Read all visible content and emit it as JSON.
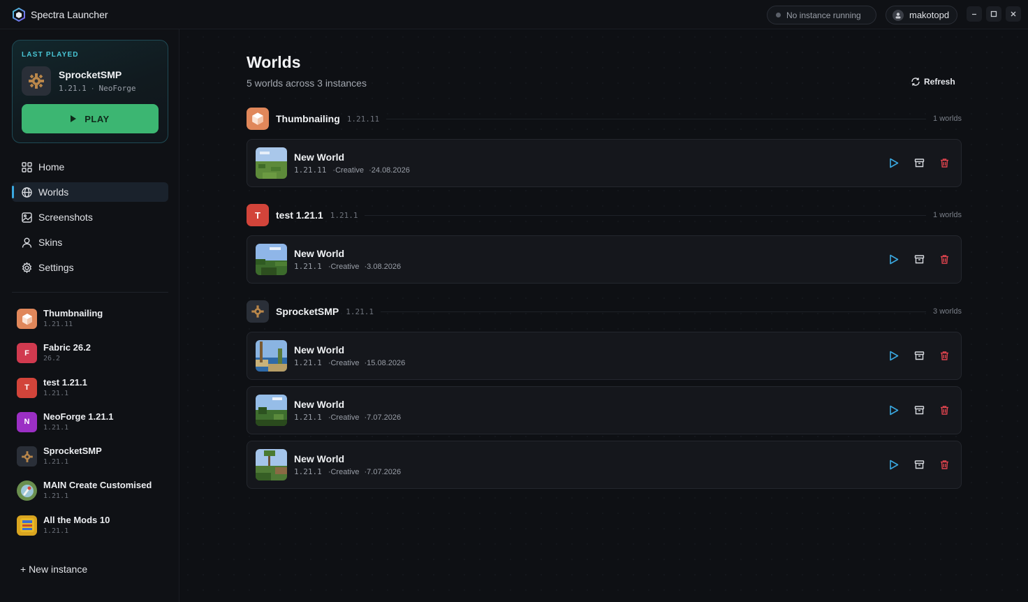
{
  "app": {
    "title": "Spectra Launcher"
  },
  "titlebar": {
    "status": "No instance running",
    "user": "makotopd"
  },
  "last_played": {
    "label": "LAST PLAYED",
    "name": "SprocketSMP",
    "version": "1.21.1",
    "sep": "·",
    "loader": "NeoForge",
    "play_label": "PLAY"
  },
  "nav": {
    "home": "Home",
    "worlds": "Worlds",
    "screenshots": "Screenshots",
    "skins": "Skins",
    "settings": "Settings"
  },
  "instances": [
    {
      "name": "Thumbnailing",
      "version": "1.21.11",
      "letter": "",
      "color": "#e0875a"
    },
    {
      "name": "Fabric 26.2",
      "version": "26.2",
      "letter": "F",
      "color": "#d13a4f"
    },
    {
      "name": "test 1.21.1",
      "version": "1.21.1",
      "letter": "T",
      "color": "#d2443a"
    },
    {
      "name": "NeoForge 1.21.1",
      "version": "1.21.1",
      "letter": "N",
      "color": "#9b2fc4"
    },
    {
      "name": "SprocketSMP",
      "version": "1.21.1",
      "letter": "",
      "color": "#2a2f38"
    },
    {
      "name": "MAIN Create Customised",
      "version": "1.21.1",
      "letter": "",
      "color": "#6a8f4e"
    },
    {
      "name": "All the Mods 10",
      "version": "1.21.1",
      "letter": "",
      "color": "#d9a520"
    }
  ],
  "new_instance": "+ New instance",
  "page": {
    "title": "Worlds",
    "subtitle": "5 worlds across 3 instances",
    "refresh": "Refresh"
  },
  "groups": [
    {
      "name": "Thumbnailing",
      "version": "1.21.11",
      "count": "1 worlds",
      "letter": "",
      "color": "#e0875a",
      "worlds": [
        {
          "name": "New World",
          "version": "1.21.11",
          "mode": "·Creative",
          "date": "·24.08.2026"
        }
      ]
    },
    {
      "name": "test 1.21.1",
      "version": "1.21.1",
      "count": "1 worlds",
      "letter": "T",
      "color": "#d2443a",
      "worlds": [
        {
          "name": "New World",
          "version": "1.21.1",
          "mode": "·Creative",
          "date": "·3.08.2026"
        }
      ]
    },
    {
      "name": "SprocketSMP",
      "version": "1.21.1",
      "count": "3 worlds",
      "letter": "",
      "color": "#2a2f38",
      "worlds": [
        {
          "name": "New World",
          "version": "1.21.1",
          "mode": "·Creative",
          "date": "·15.08.2026"
        },
        {
          "name": "New World",
          "version": "1.21.1",
          "mode": "·Creative",
          "date": "·7.07.2026"
        },
        {
          "name": "New World",
          "version": "1.21.1",
          "mode": "·Creative",
          "date": "·7.07.2026"
        }
      ]
    }
  ],
  "colors": {
    "accent": "#3aa8e0",
    "play": "#3cb672",
    "delete": "#e0444e",
    "play_icon": "#3aa8e0"
  }
}
